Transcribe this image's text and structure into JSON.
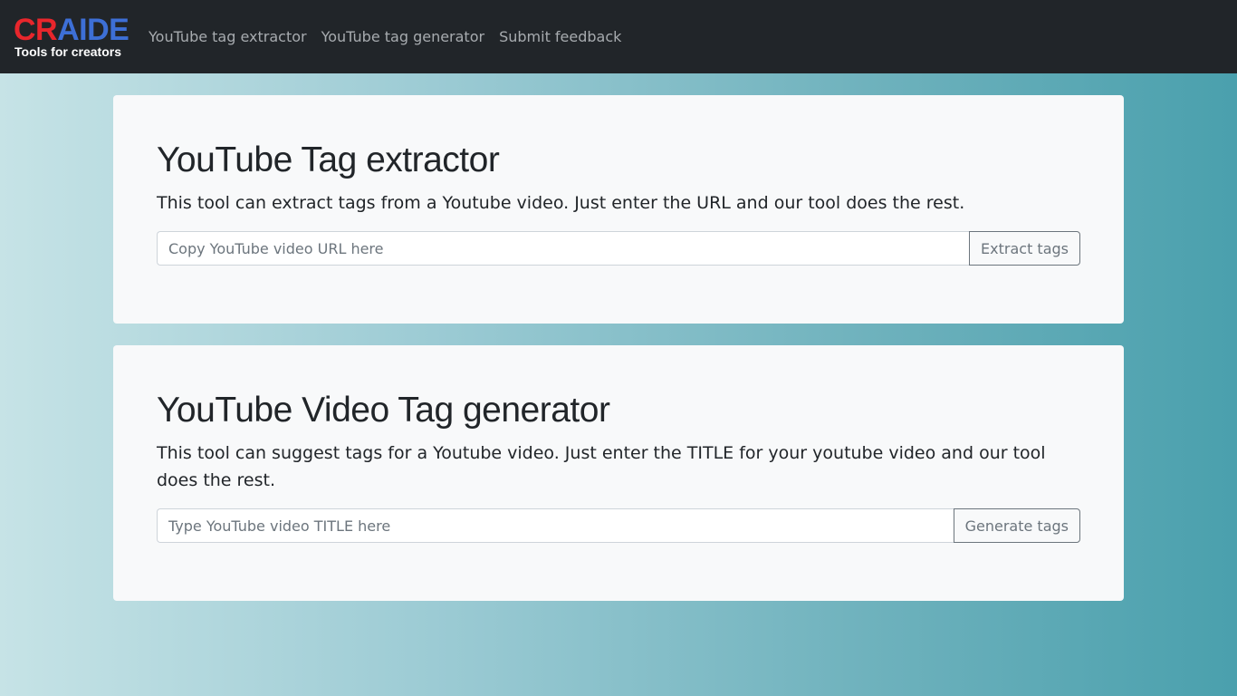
{
  "brand": {
    "word_cr": "CR",
    "word_aide": "AIDE",
    "tagline": "Tools for creators",
    "colors": {
      "cr": "#e8262c",
      "aide": "#3d6fd6"
    }
  },
  "nav": {
    "items": [
      {
        "label": "YouTube tag extractor"
      },
      {
        "label": "YouTube tag generator"
      },
      {
        "label": "Submit feedback"
      }
    ]
  },
  "extractor": {
    "title": "YouTube Tag extractor",
    "description": "This tool can extract tags from a Youtube video. Just enter the URL and our tool does the rest.",
    "input_value": "",
    "input_placeholder": "Copy YouTube video URL here",
    "button_label": "Extract tags"
  },
  "generator": {
    "title": "YouTube Video Tag generator",
    "description": "This tool can suggest tags for a Youtube video. Just enter the TITLE for your youtube video and our tool does the rest.",
    "input_value": "",
    "input_placeholder": "Type YouTube video TITLE here",
    "button_label": "Generate tags"
  }
}
